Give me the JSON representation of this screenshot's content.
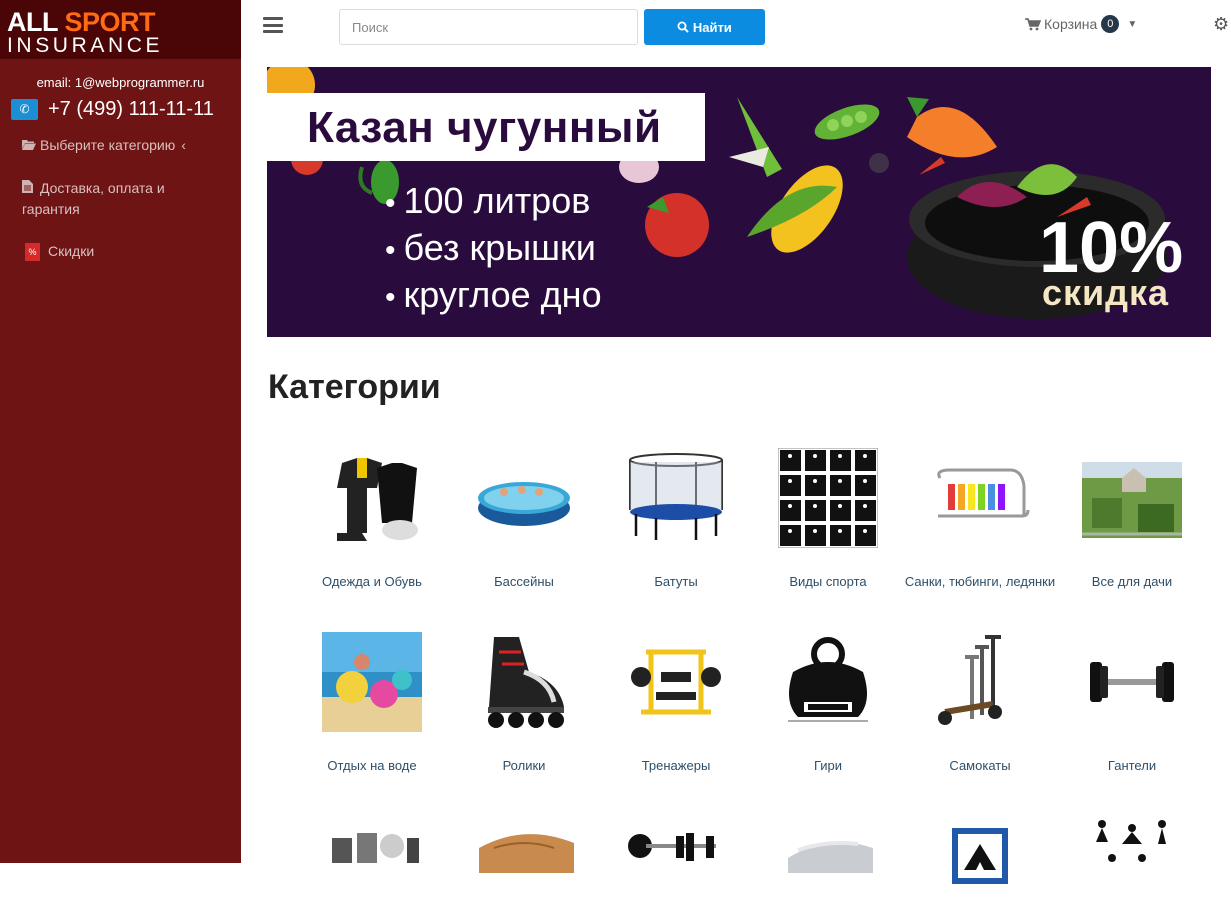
{
  "sidebar": {
    "logo": {
      "word1": "ALL",
      "word2": "SPORT",
      "word3": "INSURANCE"
    },
    "email": "email: 1@webprogrammer.ru",
    "phone": "+7 (499) 111-11-11",
    "nav": [
      {
        "label": "Выберите категорию",
        "icon": "folder-open-icon"
      },
      {
        "label": "Доставка, оплата и гарантия",
        "icon": "document-icon"
      },
      {
        "label": "Скидки",
        "icon": "percent-icon"
      }
    ]
  },
  "topbar": {
    "search": {
      "placeholder": "Поиск",
      "button": "Найти"
    },
    "cart": {
      "label": "Корзина",
      "count": "0"
    }
  },
  "banner": {
    "title": "Казан чугунный",
    "bullets": [
      "100 литров",
      "без крышки",
      "круглое дно"
    ],
    "discount_value": "10%",
    "discount_word": "скидка"
  },
  "main": {
    "heading": "Категории",
    "categories": [
      {
        "label": "Одежда и Обувь",
        "icon": "clothing-icon"
      },
      {
        "label": "Бассейны",
        "icon": "pool-icon"
      },
      {
        "label": "Батуты",
        "icon": "trampoline-icon"
      },
      {
        "label": "Виды спорта",
        "icon": "sports-pictograms-icon"
      },
      {
        "label": "Санки, тюбинги, ледянки",
        "icon": "sled-icon"
      },
      {
        "label": "Все для дачи",
        "icon": "garden-icon"
      },
      {
        "label": "Отдых на воде",
        "icon": "beach-icon"
      },
      {
        "label": "Ролики",
        "icon": "rollerblade-icon"
      },
      {
        "label": "Тренажеры",
        "icon": "gym-machine-icon"
      },
      {
        "label": "Гири",
        "icon": "kettlebell-icon"
      },
      {
        "label": "Самокаты",
        "icon": "scooter-icon"
      },
      {
        "label": "Гантели",
        "icon": "dumbbell-icon"
      },
      {
        "label": "",
        "icon": "accessories-icon"
      },
      {
        "label": "",
        "icon": "skateboard-icon"
      },
      {
        "label": "",
        "icon": "barbell-icon"
      },
      {
        "label": "",
        "icon": "air-mattress-icon"
      },
      {
        "label": "",
        "icon": "camping-sign-icon"
      },
      {
        "label": "",
        "icon": "yoga-icon"
      }
    ]
  }
}
